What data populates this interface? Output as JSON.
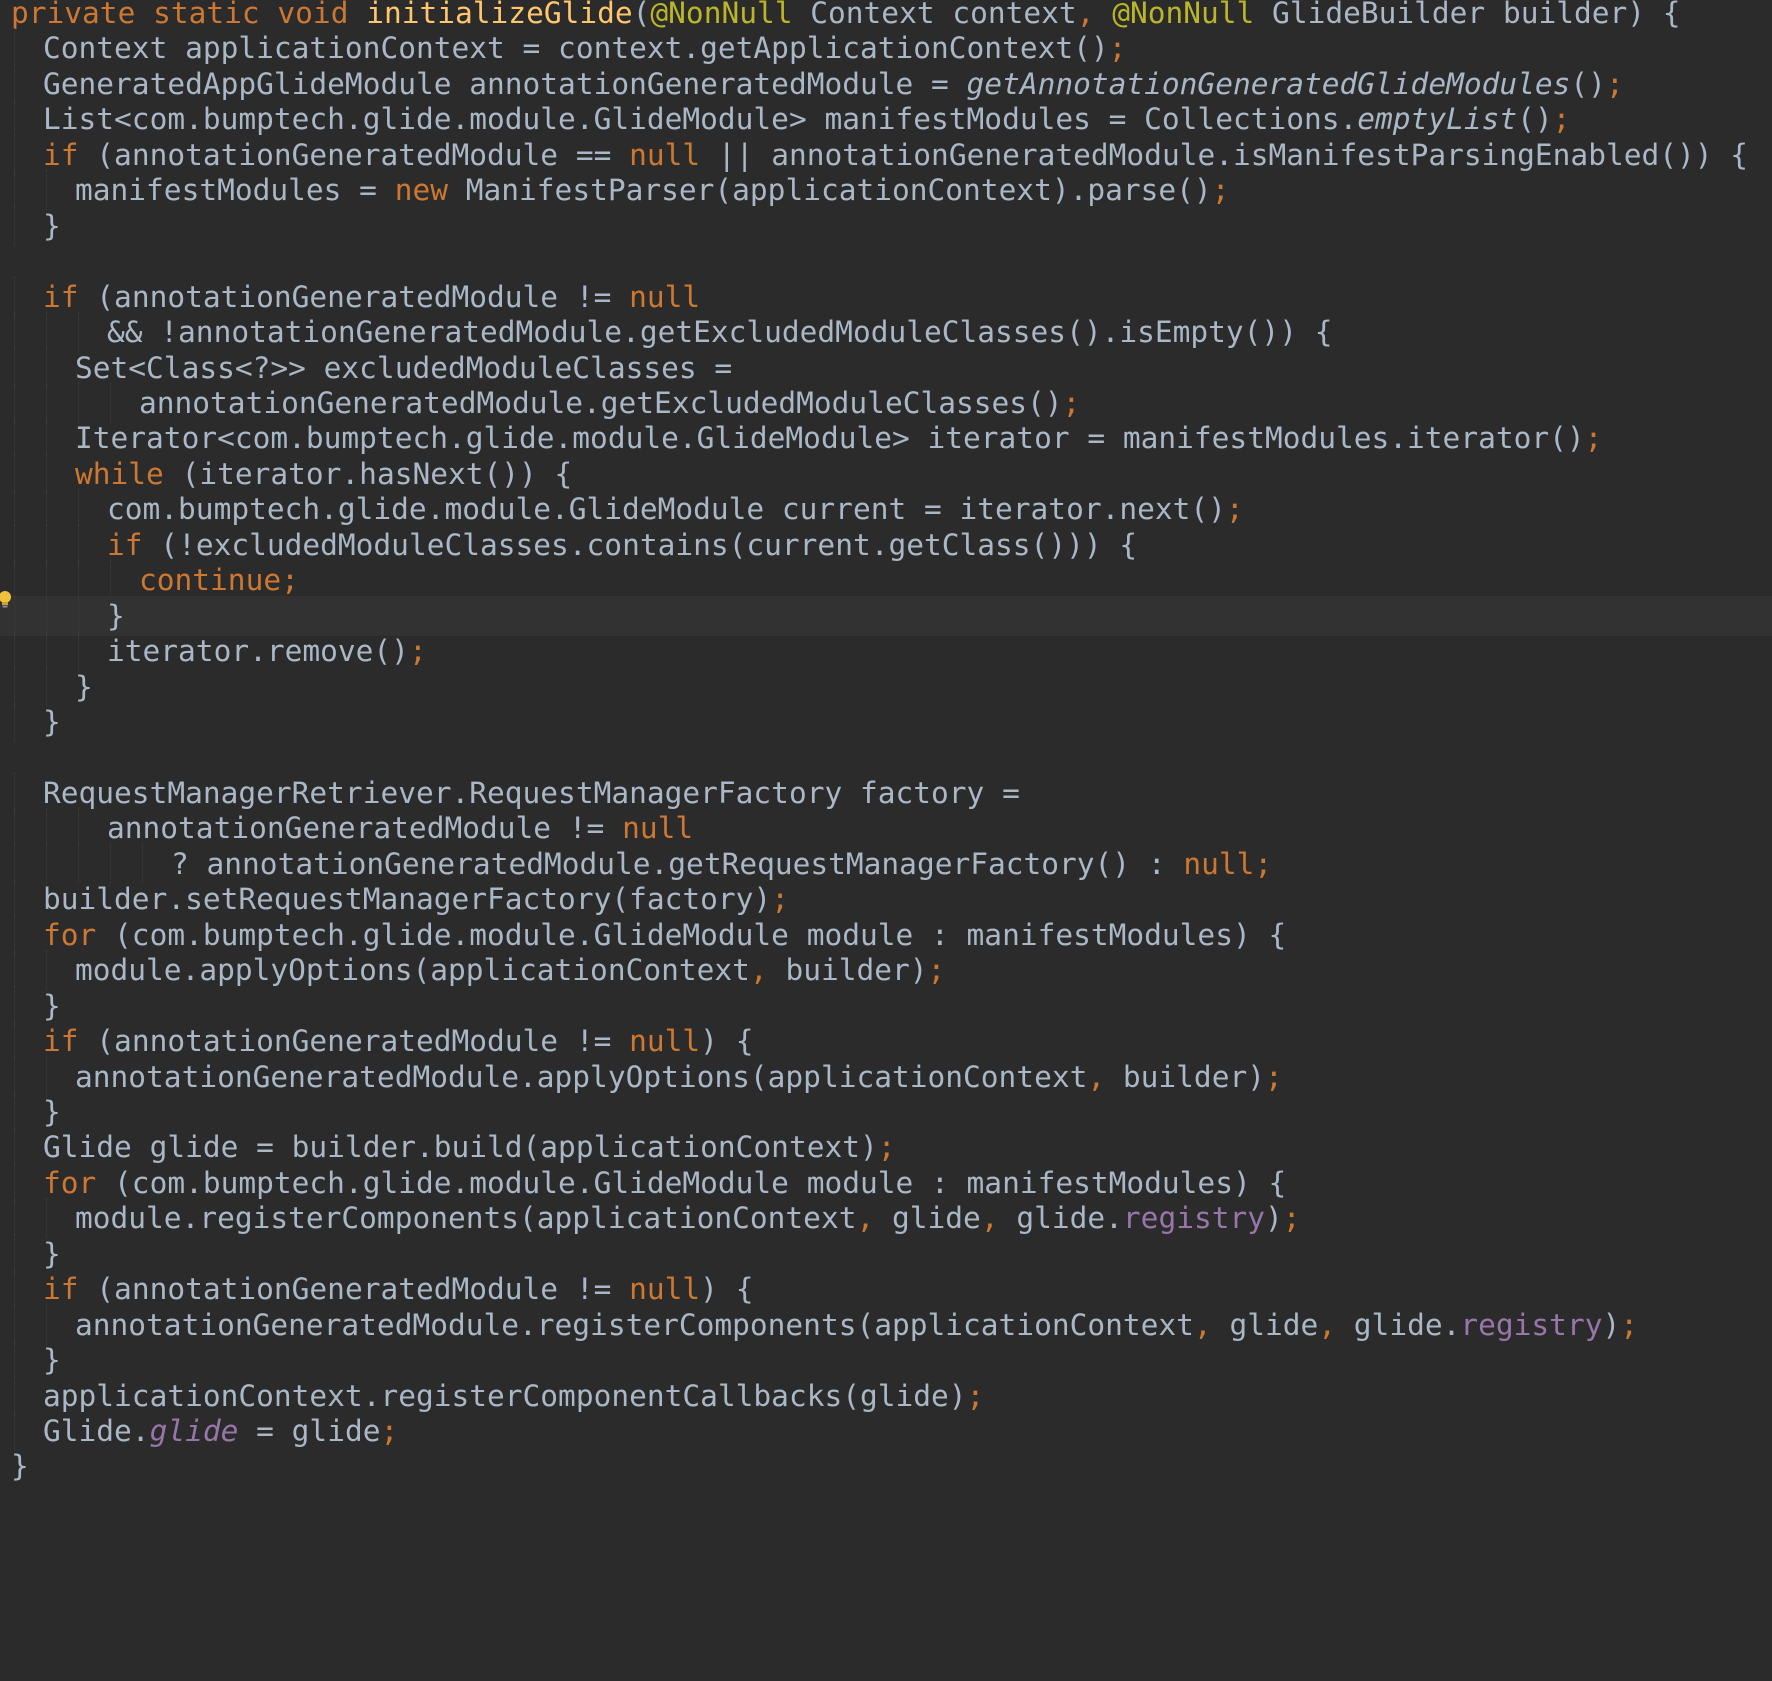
{
  "editor": {
    "theme": "Darcula",
    "current_line_index": 17,
    "colors": {
      "background": "#2b2b2b",
      "current_line": "#323232",
      "default_text": "#a9b7c6",
      "keyword": "#cc7832",
      "annotation": "#bbb529",
      "method_declaration": "#ffc66d",
      "field": "#9876aa"
    },
    "gutter_icon": "intention-bulb-icon",
    "lines": [
      {
        "indent": 0,
        "tokens": [
          {
            "t": "private static void ",
            "c": "kw"
          },
          {
            "t": "initializeGlide",
            "c": "fn"
          },
          {
            "t": "("
          },
          {
            "t": "@NonNull",
            "c": "ann"
          },
          {
            "t": " Context context"
          },
          {
            "t": ", ",
            "c": "kw"
          },
          {
            "t": "@NonNull",
            "c": "ann"
          },
          {
            "t": " GlideBuilder builder) {"
          }
        ]
      },
      {
        "indent": 1,
        "tokens": [
          {
            "t": "Context applicationContext = context.getApplicationContext()"
          },
          {
            "t": ";",
            "c": "kw"
          }
        ]
      },
      {
        "indent": 1,
        "tokens": [
          {
            "t": "GeneratedAppGlideModule annotationGeneratedModule = "
          },
          {
            "t": "getAnnotationGeneratedGlideModules",
            "c": "it"
          },
          {
            "t": "()"
          },
          {
            "t": ";",
            "c": "kw"
          }
        ]
      },
      {
        "indent": 1,
        "tokens": [
          {
            "t": "List<com.bumptech.glide.module.GlideModule> manifestModules = Collections."
          },
          {
            "t": "emptyList",
            "c": "it"
          },
          {
            "t": "()"
          },
          {
            "t": ";",
            "c": "kw"
          }
        ]
      },
      {
        "indent": 1,
        "tokens": [
          {
            "t": "if ",
            "c": "kw"
          },
          {
            "t": "(annotationGeneratedModule == "
          },
          {
            "t": "null",
            "c": "kw"
          },
          {
            "t": " || annotationGeneratedModule.isManifestParsingEnabled()) {"
          }
        ]
      },
      {
        "indent": 2,
        "tokens": [
          {
            "t": "manifestModules = "
          },
          {
            "t": "new ",
            "c": "kw"
          },
          {
            "t": "ManifestParser(applicationContext).parse()"
          },
          {
            "t": ";",
            "c": "kw"
          }
        ]
      },
      {
        "indent": 1,
        "tokens": [
          {
            "t": "}"
          }
        ]
      },
      {
        "indent": 0,
        "tokens": []
      },
      {
        "indent": 1,
        "tokens": [
          {
            "t": "if ",
            "c": "kw"
          },
          {
            "t": "(annotationGeneratedModule != "
          },
          {
            "t": "null",
            "c": "kw"
          }
        ]
      },
      {
        "indent": 3,
        "tokens": [
          {
            "t": "&& !annotationGeneratedModule.getExcludedModuleClasses().isEmpty()) {"
          }
        ]
      },
      {
        "indent": 2,
        "tokens": [
          {
            "t": "Set<Class<?>> excludedModuleClasses ="
          }
        ]
      },
      {
        "indent": 4,
        "tokens": [
          {
            "t": "annotationGeneratedModule.getExcludedModuleClasses()"
          },
          {
            "t": ";",
            "c": "kw"
          }
        ]
      },
      {
        "indent": 2,
        "tokens": [
          {
            "t": "Iterator<com.bumptech.glide.module.GlideModule> iterator = manifestModules.iterator()"
          },
          {
            "t": ";",
            "c": "kw"
          }
        ]
      },
      {
        "indent": 2,
        "tokens": [
          {
            "t": "while ",
            "c": "kw"
          },
          {
            "t": "(iterator.hasNext()) {"
          }
        ]
      },
      {
        "indent": 3,
        "tokens": [
          {
            "t": "com.bumptech.glide.module.GlideModule current = iterator.next()"
          },
          {
            "t": ";",
            "c": "kw"
          }
        ]
      },
      {
        "indent": 3,
        "tokens": [
          {
            "t": "if ",
            "c": "kw"
          },
          {
            "t": "(!excludedModuleClasses.contains(current.getClass())) {"
          }
        ]
      },
      {
        "indent": 4,
        "tokens": [
          {
            "t": "continue;",
            "c": "kw"
          }
        ]
      },
      {
        "indent": 3,
        "tokens": [
          {
            "t": "}"
          }
        ]
      },
      {
        "indent": 3,
        "tokens": [
          {
            "t": "iterator.remove()"
          },
          {
            "t": ";",
            "c": "kw"
          }
        ]
      },
      {
        "indent": 2,
        "tokens": [
          {
            "t": "}"
          }
        ]
      },
      {
        "indent": 1,
        "tokens": [
          {
            "t": "}"
          }
        ]
      },
      {
        "indent": 0,
        "tokens": []
      },
      {
        "indent": 1,
        "tokens": [
          {
            "t": "RequestManagerRetriever.RequestManagerFactory factory ="
          }
        ]
      },
      {
        "indent": 3,
        "tokens": [
          {
            "t": "annotationGeneratedModule != "
          },
          {
            "t": "null",
            "c": "kw"
          }
        ]
      },
      {
        "indent": 5,
        "tokens": [
          {
            "t": "? annotationGeneratedModule.getRequestManagerFactory() : "
          },
          {
            "t": "null;",
            "c": "kw"
          }
        ]
      },
      {
        "indent": 1,
        "tokens": [
          {
            "t": "builder.setRequestManagerFactory(factory)"
          },
          {
            "t": ";",
            "c": "kw"
          }
        ]
      },
      {
        "indent": 1,
        "tokens": [
          {
            "t": "for ",
            "c": "kw"
          },
          {
            "t": "(com.bumptech.glide.module.GlideModule module : manifestModules) {"
          }
        ]
      },
      {
        "indent": 2,
        "tokens": [
          {
            "t": "module.applyOptions(applicationContext"
          },
          {
            "t": ", ",
            "c": "kw"
          },
          {
            "t": "builder)"
          },
          {
            "t": ";",
            "c": "kw"
          }
        ]
      },
      {
        "indent": 1,
        "tokens": [
          {
            "t": "}"
          }
        ]
      },
      {
        "indent": 1,
        "tokens": [
          {
            "t": "if ",
            "c": "kw"
          },
          {
            "t": "(annotationGeneratedModule != "
          },
          {
            "t": "null",
            "c": "kw"
          },
          {
            "t": ") {"
          }
        ]
      },
      {
        "indent": 2,
        "tokens": [
          {
            "t": "annotationGeneratedModule.applyOptions(applicationContext"
          },
          {
            "t": ", ",
            "c": "kw"
          },
          {
            "t": "builder)"
          },
          {
            "t": ";",
            "c": "kw"
          }
        ]
      },
      {
        "indent": 1,
        "tokens": [
          {
            "t": "}"
          }
        ]
      },
      {
        "indent": 1,
        "tokens": [
          {
            "t": "Glide glide = builder.build(applicationContext)"
          },
          {
            "t": ";",
            "c": "kw"
          }
        ]
      },
      {
        "indent": 1,
        "tokens": [
          {
            "t": "for ",
            "c": "kw"
          },
          {
            "t": "(com.bumptech.glide.module.GlideModule module : manifestModules) {"
          }
        ]
      },
      {
        "indent": 2,
        "tokens": [
          {
            "t": "module.registerComponents(applicationContext"
          },
          {
            "t": ", ",
            "c": "kw"
          },
          {
            "t": "glide"
          },
          {
            "t": ", ",
            "c": "kw"
          },
          {
            "t": "glide."
          },
          {
            "t": "registry",
            "c": "field"
          },
          {
            "t": ")"
          },
          {
            "t": ";",
            "c": "kw"
          }
        ]
      },
      {
        "indent": 1,
        "tokens": [
          {
            "t": "}"
          }
        ]
      },
      {
        "indent": 1,
        "tokens": [
          {
            "t": "if ",
            "c": "kw"
          },
          {
            "t": "(annotationGeneratedModule != "
          },
          {
            "t": "null",
            "c": "kw"
          },
          {
            "t": ") {"
          }
        ]
      },
      {
        "indent": 2,
        "tokens": [
          {
            "t": "annotationGeneratedModule.registerComponents(applicationContext"
          },
          {
            "t": ", ",
            "c": "kw"
          },
          {
            "t": "glide"
          },
          {
            "t": ", ",
            "c": "kw"
          },
          {
            "t": "glide."
          },
          {
            "t": "registry",
            "c": "field"
          },
          {
            "t": ")"
          },
          {
            "t": ";",
            "c": "kw"
          }
        ]
      },
      {
        "indent": 1,
        "tokens": [
          {
            "t": "}"
          }
        ]
      },
      {
        "indent": 1,
        "tokens": [
          {
            "t": "applicationContext.registerComponentCallbacks(glide)"
          },
          {
            "t": ";",
            "c": "kw"
          }
        ]
      },
      {
        "indent": 1,
        "tokens": [
          {
            "t": "Glide."
          },
          {
            "t": "glide",
            "c": "static"
          },
          {
            "t": " = glide"
          },
          {
            "t": ";",
            "c": "kw"
          }
        ]
      },
      {
        "indent": 0,
        "tokens": [
          {
            "t": "}"
          }
        ]
      }
    ]
  }
}
